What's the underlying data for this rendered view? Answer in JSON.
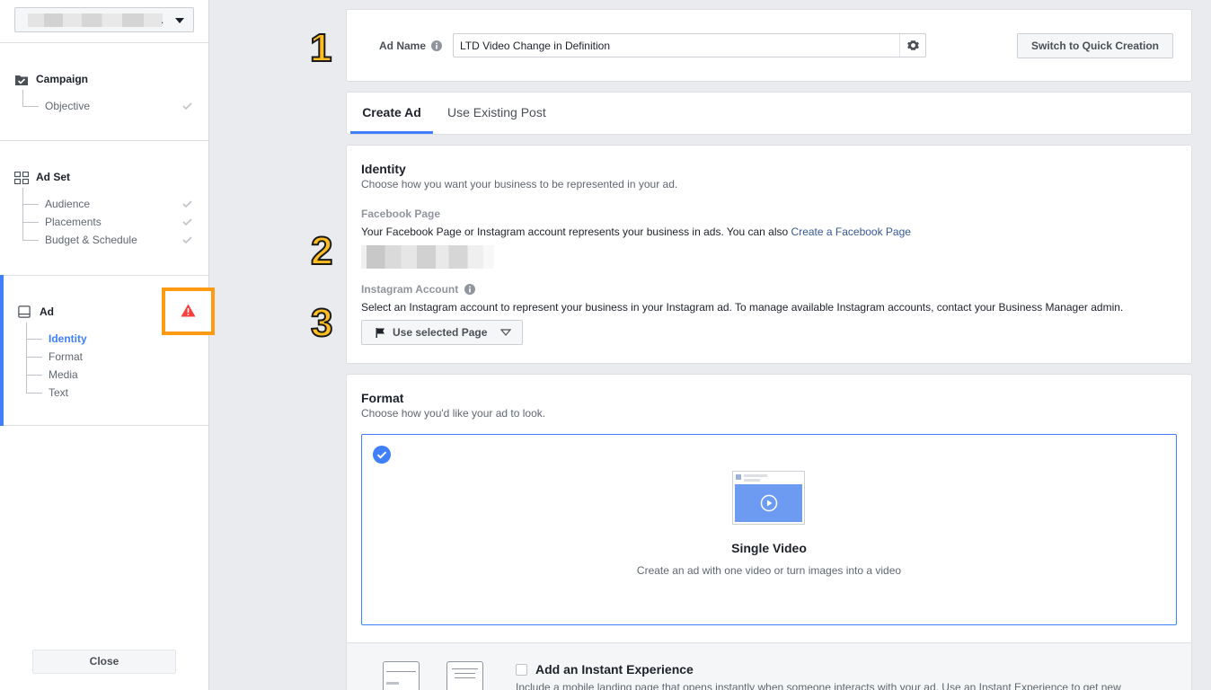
{
  "sidebar": {
    "account_suffix": ".",
    "campaign": {
      "title": "Campaign",
      "items": [
        "Objective"
      ]
    },
    "adset": {
      "title": "Ad Set",
      "items": [
        "Audience",
        "Placements",
        "Budget & Schedule"
      ]
    },
    "ad": {
      "title": "Ad",
      "items": [
        "Identity",
        "Format",
        "Media",
        "Text"
      ],
      "active_item": "Identity"
    },
    "close_label": "Close"
  },
  "annotations": [
    "1",
    "2",
    "3"
  ],
  "header": {
    "ad_name_label": "Ad Name",
    "ad_name_value": "LTD Video Change in Definition",
    "switch_label": "Switch to Quick Creation"
  },
  "tabs": [
    "Create Ad",
    "Use Existing Post"
  ],
  "identity": {
    "title": "Identity",
    "subtitle": "Choose how you want your business to be represented in your ad.",
    "facebook_page_label": "Facebook Page",
    "facebook_page_text": "Your Facebook Page or Instagram account represents your business in ads. You can also ",
    "facebook_page_link": "Create a Facebook Page",
    "instagram_label": "Instagram Account",
    "instagram_text": "Select an Instagram account to represent your business in your Instagram ad. To manage available Instagram accounts, contact your Business Manager admin.",
    "instagram_select": "Use selected Page"
  },
  "format": {
    "title": "Format",
    "subtitle": "Choose how you'd like your ad to look.",
    "option_title": "Single Video",
    "option_desc": "Create an ad with one video or turn images into a video",
    "instant_title": "Add an Instant Experience",
    "instant_desc": "Include a mobile landing page that opens instantly when someone interacts with your ad. Use an Instant Experience to get new"
  },
  "colors": {
    "accent": "#4080ff",
    "warning": "#fa3e3e",
    "highlight": "#ff9a15",
    "link": "#365899"
  }
}
